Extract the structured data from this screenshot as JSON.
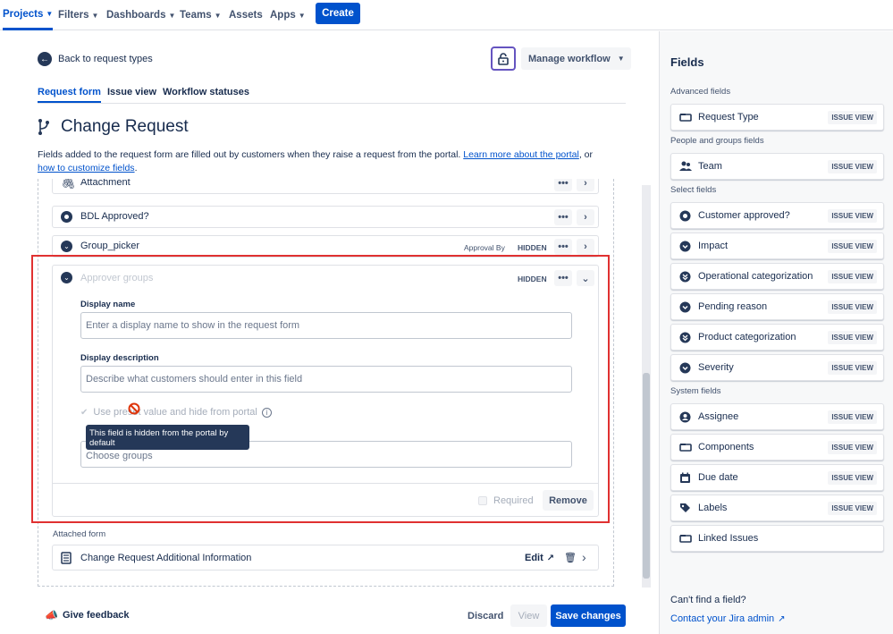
{
  "nav": {
    "items": [
      {
        "label": "Projects"
      },
      {
        "label": "Filters"
      },
      {
        "label": "Dashboards"
      },
      {
        "label": "Teams"
      },
      {
        "label": "Assets"
      },
      {
        "label": "Apps"
      }
    ],
    "create_label": "Create"
  },
  "header": {
    "back_label": "Back to request types",
    "manage_workflow_label": "Manage workflow",
    "tabs": [
      {
        "label": "Request form"
      },
      {
        "label": "Issue view"
      },
      {
        "label": "Workflow statuses"
      }
    ],
    "title": "Change Request",
    "description_part1": "Fields added to the request form are filled out by customers when they raise a request from the portal. ",
    "learn_more_link": "Learn more about the portal",
    "description_part2": ", or",
    "customize_link": "how to customize fields",
    "description_end": "."
  },
  "fields_list": {
    "rows": [
      {
        "label": "Attachment"
      },
      {
        "label": "BDL Approved?"
      },
      {
        "label": "Group_picker",
        "approval_label": "Approval By",
        "badge": "HIDDEN"
      }
    ],
    "more_glyph": "•••",
    "expanded": {
      "label": "Approver groups",
      "badge": "HIDDEN",
      "display_name_label": "Display name",
      "display_name_placeholder": "Enter a display name to show in the request form",
      "display_description_label": "Display description",
      "display_description_placeholder": "Describe what customers should enter in this field",
      "preset_checkbox_label": "Use preset value and hide from portal",
      "tooltip_text": "This field is hidden from the portal by default",
      "groups_placeholder": "Choose groups",
      "required_label": "Required",
      "remove_label": "Remove"
    },
    "attached_form_heading": "Attached form",
    "attached_form_name": "Change Request Additional Information",
    "attached_form_edit": "Edit"
  },
  "footer": {
    "feedback_label": "Give feedback",
    "discard_label": "Discard",
    "view_label": "View",
    "save_label": "Save changes"
  },
  "sidebar": {
    "title": "Fields",
    "groups": [
      {
        "heading": "Advanced fields",
        "items": [
          {
            "label": "Request Type",
            "badge": "ISSUE VIEW",
            "icon": "rect"
          }
        ]
      },
      {
        "heading": "People and groups fields",
        "items": [
          {
            "label": "Team",
            "badge": "ISSUE VIEW",
            "icon": "people"
          }
        ]
      },
      {
        "heading": "Select fields",
        "items": [
          {
            "label": "Customer approved?",
            "badge": "ISSUE VIEW",
            "icon": "radio"
          },
          {
            "label": "Impact",
            "badge": "ISSUE VIEW",
            "icon": "select"
          },
          {
            "label": "Operational categorization",
            "badge": "ISSUE VIEW",
            "icon": "cascade"
          },
          {
            "label": "Pending reason",
            "badge": "ISSUE VIEW",
            "icon": "select"
          },
          {
            "label": "Product categorization",
            "badge": "ISSUE VIEW",
            "icon": "cascade"
          },
          {
            "label": "Severity",
            "badge": "ISSUE VIEW",
            "icon": "select"
          }
        ]
      },
      {
        "heading": "System fields",
        "items": [
          {
            "label": "Assignee",
            "badge": "ISSUE VIEW",
            "icon": "user"
          },
          {
            "label": "Components",
            "badge": "ISSUE VIEW",
            "icon": "rect"
          },
          {
            "label": "Due date",
            "badge": "ISSUE VIEW",
            "icon": "calendar"
          },
          {
            "label": "Labels",
            "badge": "ISSUE VIEW",
            "icon": "tag"
          },
          {
            "label": "Linked Issues",
            "badge": "",
            "icon": "rect"
          }
        ]
      }
    ],
    "cant_find": "Can't find a field?",
    "contact_admin": "Contact your Jira admin"
  },
  "colors": {
    "primary": "#0052cc",
    "highlight_border": "#e03131",
    "tooltip_bg": "#253858"
  }
}
